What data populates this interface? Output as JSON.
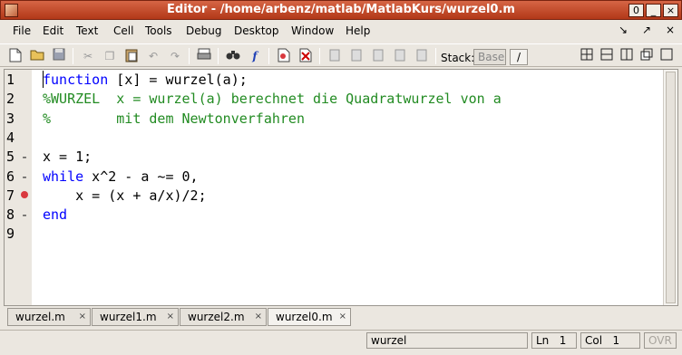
{
  "window": {
    "title": "Editor - /home/arbenz/matlab/MatlabKurs/wurzel0.m",
    "buttons": [
      "0",
      "_",
      "×"
    ]
  },
  "menu": {
    "items": [
      {
        "label": "File"
      },
      {
        "label": "Edit"
      },
      {
        "label": "Text"
      },
      {
        "label": "Cell"
      },
      {
        "label": "Tools"
      },
      {
        "label": "Debug"
      },
      {
        "label": "Desktop"
      },
      {
        "label": "Window"
      },
      {
        "label": "Help"
      }
    ],
    "right_glyphs": [
      "↘",
      "↗",
      "×"
    ]
  },
  "toolbar": {
    "stack_label": "Stack:",
    "stack_value": "Base",
    "stack_button": "/"
  },
  "editor": {
    "lines": [
      {
        "n": "1",
        "mark": "",
        "parts": [
          {
            "t": "function",
            "c": "kw"
          },
          {
            "t": " [x] = wurzel(a);",
            "c": ""
          }
        ]
      },
      {
        "n": "2",
        "mark": "",
        "parts": [
          {
            "t": "%WURZEL  x = wurzel(a) berechnet die Quadratwurzel von a",
            "c": "cm"
          }
        ]
      },
      {
        "n": "3",
        "mark": "",
        "parts": [
          {
            "t": "%        mit dem Newtonverfahren",
            "c": "cm"
          }
        ]
      },
      {
        "n": "4",
        "mark": "",
        "parts": []
      },
      {
        "n": "5",
        "mark": "-",
        "parts": [
          {
            "t": "x = 1;",
            "c": ""
          }
        ]
      },
      {
        "n": "6",
        "mark": "-",
        "parts": [
          {
            "t": "while",
            "c": "kw"
          },
          {
            "t": " x^2 - a ~= 0,",
            "c": ""
          }
        ]
      },
      {
        "n": "7",
        "mark": "bp",
        "parts": [
          {
            "t": "    x = (x + a/x)/2;",
            "c": ""
          }
        ]
      },
      {
        "n": "8",
        "mark": "-",
        "parts": [
          {
            "t": "end",
            "c": "kw"
          }
        ]
      },
      {
        "n": "9",
        "mark": "",
        "parts": []
      }
    ]
  },
  "tabs": [
    {
      "label": "wurzel.m",
      "close": "×",
      "active": false
    },
    {
      "label": "wurzel1.m",
      "close": "×",
      "active": false
    },
    {
      "label": "wurzel2.m",
      "close": "×",
      "active": false
    },
    {
      "label": "wurzel0.m",
      "close": "×",
      "active": true
    }
  ],
  "status": {
    "function": "wurzel",
    "ln_label": "Ln",
    "ln_value": "1",
    "col_label": "Col",
    "col_value": "1",
    "ovr": "OVR"
  },
  "colors": {
    "keyword": "#0000ff",
    "comment": "#228b22",
    "breakpoint": "#d9393f",
    "titlebar": "#c04a28"
  }
}
